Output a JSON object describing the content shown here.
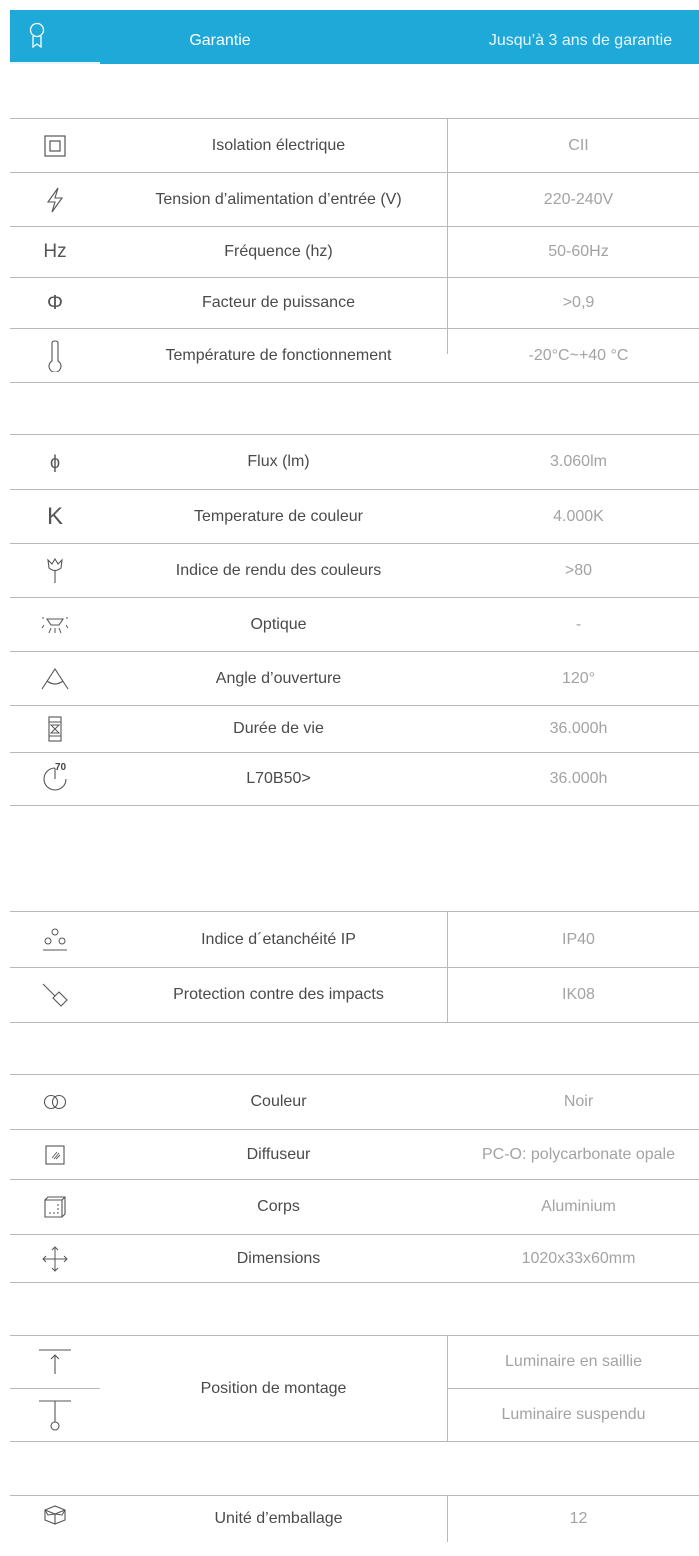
{
  "header": {
    "label": "Garantie",
    "value": "Jusqu’à 3 ans de garantie",
    "icon": "warranty-ribbon-icon"
  },
  "electrical": [
    {
      "icon": "insulation-class-icon",
      "label": "Isolation électrique",
      "value": "CII"
    },
    {
      "icon": "lightning-icon",
      "label": "Tension d’alimentation d’entrée (V)",
      "value": "220-240V"
    },
    {
      "icon": "hz-icon",
      "icon_text": "Hz",
      "label": "Fréquence (hz)",
      "value": "50-60Hz"
    },
    {
      "icon": "phi-icon",
      "icon_text": "Φ",
      "label": "Facteur de puissance",
      "value": ">0,9"
    },
    {
      "icon": "thermometer-icon",
      "label": "Température de fonctionnement",
      "value": "-20°C~+40 °C"
    }
  ],
  "photometric": [
    {
      "icon": "flux-icon",
      "icon_text": "ϕ",
      "label": "Flux (lm)",
      "value": "3.060lm"
    },
    {
      "icon": "kelvin-icon",
      "icon_text": "K",
      "label": "Temperature de couleur",
      "value": "4.000K"
    },
    {
      "icon": "tulip-icon",
      "label": "Indice de rendu des couleurs",
      "value": ">80"
    },
    {
      "icon": "optic-icon",
      "label": "Optique",
      "value": "-"
    },
    {
      "icon": "beam-angle-icon",
      "label": "Angle d’ouverture",
      "value": "120°"
    },
    {
      "icon": "hourglass-icon",
      "label": "Durée de vie",
      "value": "36.000h"
    },
    {
      "icon": "l70-icon",
      "icon_text": "70",
      "label": "L70B50>",
      "value": "36.000h"
    }
  ],
  "protection": [
    {
      "icon": "ip-droplets-icon",
      "label": "Indice d´etanchéité IP",
      "value": "IP40"
    },
    {
      "icon": "hammer-impact-icon",
      "label": "Protection contre des impacts",
      "value": "IK08"
    }
  ],
  "materials": [
    {
      "icon": "color-rings-icon",
      "label": "Couleur",
      "value": "Noir"
    },
    {
      "icon": "diffuser-icon",
      "label": "Diffuseur",
      "value": "PC-O: polycarbonate opale"
    },
    {
      "icon": "body-cube-icon",
      "label": "Corps",
      "value": "Aluminium"
    },
    {
      "icon": "dimensions-arrows-icon",
      "label": "Dimensions",
      "value": "1020x33x60mm"
    }
  ],
  "mounting": {
    "label": "Position de montage",
    "icons": [
      "surface-mount-icon",
      "suspended-mount-icon"
    ],
    "values": [
      "Luminaire en saillie",
      "Luminaire suspendu"
    ]
  },
  "packaging": {
    "icon": "box-icon",
    "label": "Unité d’emballage",
    "value": "12"
  }
}
